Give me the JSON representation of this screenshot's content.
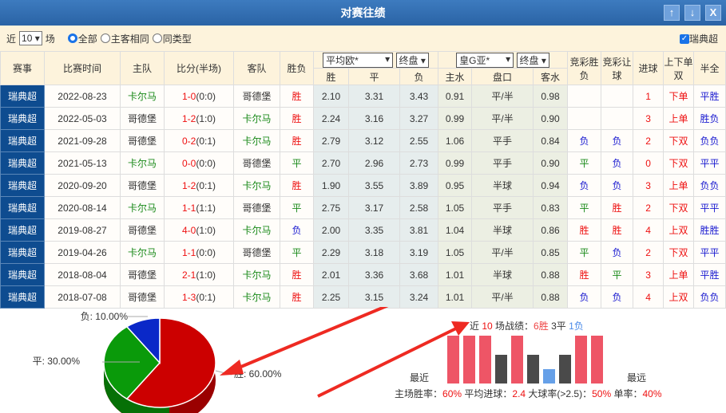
{
  "title": "对赛往绩",
  "title_buttons": [
    "↑",
    "↓",
    "X"
  ],
  "filter": {
    "prefix": "近",
    "count": "10",
    "suffix": "场",
    "radios": [
      {
        "label": "全部",
        "checked": true
      },
      {
        "label": "主客相同",
        "checked": false
      },
      {
        "label": "同类型",
        "checked": false
      }
    ],
    "league_check": "瑞典超"
  },
  "headers": {
    "league": "赛事",
    "date": "比赛时间",
    "home": "主队",
    "score": "比分(半场)",
    "away": "客队",
    "result": "胜负",
    "euro_company": "平均欧*",
    "euro_type": "终盘",
    "asia_company": "皇G亚*",
    "asia_type": "终盘",
    "jc_wl": "竞彩胜负",
    "jc_rq": "竞彩让球",
    "goals": "进球",
    "ou": "上下单双",
    "hf": "半全",
    "win": "胜",
    "draw": "平",
    "lose": "负",
    "home_water": "主水",
    "handicap": "盘口",
    "away_water": "客水"
  },
  "rows": [
    {
      "league": "瑞典超",
      "date": "2022-08-23",
      "home": "卡尔马",
      "score": "1-0",
      "half": "(0:0)",
      "away": "哥德堡",
      "result": "胜",
      "w": "2.10",
      "d": "3.31",
      "l": "3.43",
      "hw": "0.91",
      "hc": "平/半",
      "aw": "0.98",
      "jc": "",
      "rq": "",
      "goals": "1",
      "ou": "下单",
      "hf": "平胜"
    },
    {
      "league": "瑞典超",
      "date": "2022-05-03",
      "home": "哥德堡",
      "score": "1-2",
      "half": "(1:0)",
      "away": "卡尔马",
      "result": "胜",
      "w": "2.24",
      "d": "3.16",
      "l": "3.27",
      "hw": "0.99",
      "hc": "平/半",
      "aw": "0.90",
      "jc": "",
      "rq": "",
      "goals": "3",
      "ou": "上单",
      "hf": "胜负"
    },
    {
      "league": "瑞典超",
      "date": "2021-09-28",
      "home": "哥德堡",
      "score": "0-2",
      "half": "(0:1)",
      "away": "卡尔马",
      "result": "胜",
      "w": "2.79",
      "d": "3.12",
      "l": "2.55",
      "hw": "1.06",
      "hc": "平手",
      "aw": "0.84",
      "jc": "负",
      "rq": "负",
      "goals": "2",
      "ou": "下双",
      "hf": "负负"
    },
    {
      "league": "瑞典超",
      "date": "2021-05-13",
      "home": "卡尔马",
      "score": "0-0",
      "half": "(0:0)",
      "away": "哥德堡",
      "result": "平",
      "w": "2.70",
      "d": "2.96",
      "l": "2.73",
      "hw": "0.99",
      "hc": "平手",
      "aw": "0.90",
      "jc": "平",
      "rq": "负",
      "goals": "0",
      "ou": "下双",
      "hf": "平平"
    },
    {
      "league": "瑞典超",
      "date": "2020-09-20",
      "home": "哥德堡",
      "score": "1-2",
      "half": "(0:1)",
      "away": "卡尔马",
      "result": "胜",
      "w": "1.90",
      "d": "3.55",
      "l": "3.89",
      "hw": "0.95",
      "hc": "半球",
      "aw": "0.94",
      "jc": "负",
      "rq": "负",
      "goals": "3",
      "ou": "上单",
      "hf": "负负"
    },
    {
      "league": "瑞典超",
      "date": "2020-08-14",
      "home": "卡尔马",
      "score": "1-1",
      "half": "(1:1)",
      "away": "哥德堡",
      "result": "平",
      "w": "2.75",
      "d": "3.17",
      "l": "2.58",
      "hw": "1.05",
      "hc": "平手",
      "aw": "0.83",
      "jc": "平",
      "rq": "胜",
      "goals": "2",
      "ou": "下双",
      "hf": "平平"
    },
    {
      "league": "瑞典超",
      "date": "2019-08-27",
      "home": "哥德堡",
      "score": "4-0",
      "half": "(1:0)",
      "away": "卡尔马",
      "result": "负",
      "w": "2.00",
      "d": "3.35",
      "l": "3.81",
      "hw": "1.04",
      "hc": "半球",
      "aw": "0.86",
      "jc": "胜",
      "rq": "胜",
      "goals": "4",
      "ou": "上双",
      "hf": "胜胜"
    },
    {
      "league": "瑞典超",
      "date": "2019-04-26",
      "home": "卡尔马",
      "score": "1-1",
      "half": "(0:0)",
      "away": "哥德堡",
      "result": "平",
      "w": "2.29",
      "d": "3.18",
      "l": "3.19",
      "hw": "1.05",
      "hc": "平/半",
      "aw": "0.85",
      "jc": "平",
      "rq": "负",
      "goals": "2",
      "ou": "下双",
      "hf": "平平"
    },
    {
      "league": "瑞典超",
      "date": "2018-08-04",
      "home": "哥德堡",
      "score": "2-1",
      "half": "(1:0)",
      "away": "卡尔马",
      "result": "胜",
      "w": "2.01",
      "d": "3.36",
      "l": "3.68",
      "hw": "1.01",
      "hc": "半球",
      "aw": "0.88",
      "jc": "胜",
      "rq": "平",
      "goals": "3",
      "ou": "上单",
      "hf": "平胜"
    },
    {
      "league": "瑞典超",
      "date": "2018-07-08",
      "home": "哥德堡",
      "score": "1-3",
      "half": "(0:1)",
      "away": "卡尔马",
      "result": "胜",
      "w": "2.25",
      "d": "3.15",
      "l": "3.24",
      "hw": "1.01",
      "hc": "平/半",
      "aw": "0.88",
      "jc": "负",
      "rq": "负",
      "goals": "4",
      "ou": "上双",
      "hf": "负负"
    }
  ],
  "pie": {
    "slices": [
      {
        "label": "胜: 60.00%",
        "value": 60,
        "color": "#cc0000"
      },
      {
        "label": "平: 30.00%",
        "value": 30,
        "color": "#0a9a0a"
      },
      {
        "label": "负: 10.00%",
        "value": 10,
        "color": "#0a28c8"
      }
    ]
  },
  "summary": {
    "p1": "近 ",
    "n": "10",
    "p2": " 场战绩：",
    "w": "6胜",
    "d": " 3平 ",
    "l": "1负",
    "recent": "最近",
    "far": "最远",
    "bars": [
      "胜",
      "胜",
      "胜",
      "平",
      "胜",
      "平",
      "负",
      "平",
      "胜",
      "胜"
    ],
    "colors": {
      "胜": "#ee5566",
      "平": "#4a4a4a",
      "负": "#66a0e8"
    },
    "home_win_label": "主场胜率：",
    "home_win": "60%",
    "avg_goals_label": " 平均进球：",
    "avg_goals": "2.4",
    "over_label": " 大球率(>2.5)：",
    "over": "50%",
    "odd_label": " 单率：",
    "odd": "40%"
  }
}
